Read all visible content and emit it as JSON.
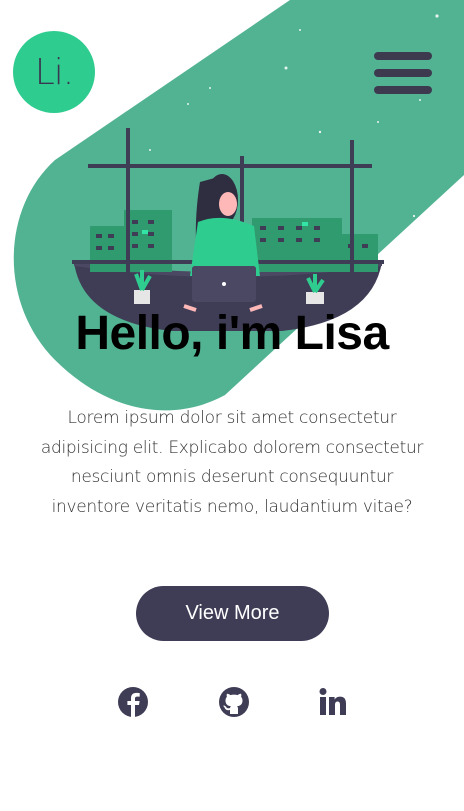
{
  "header": {
    "logo_text": "Li.",
    "menu_icon": "hamburger-menu-icon"
  },
  "hero": {
    "title": "Hello, i'm Lisa",
    "description": "Lorem ipsum dolor sit amet consectetur adipisicing elit. Explicabo dolorem consectetur nesciunt omnis deserunt consequuntur inventore veritatis nemo, laudantium vitae?",
    "button_label": "View More",
    "illustration": "woman-working-on-laptop-illustration"
  },
  "socials": [
    {
      "name": "facebook",
      "icon": "facebook-icon"
    },
    {
      "name": "github",
      "icon": "github-icon"
    },
    {
      "name": "linkedin",
      "icon": "linkedin-icon"
    }
  ],
  "colors": {
    "accent": "#52b392",
    "logo_bg": "#2fcc90",
    "dark": "#3f3d56",
    "text": "#333333"
  }
}
